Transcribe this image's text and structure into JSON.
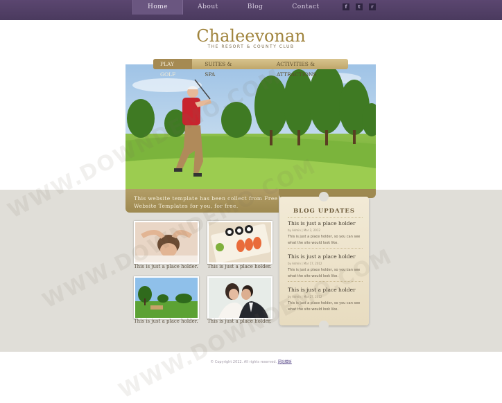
{
  "nav": {
    "items": [
      "Home",
      "About",
      "Blog",
      "Contact"
    ]
  },
  "social": {
    "icons": [
      "facebook-icon",
      "twitter-icon",
      "rss-icon"
    ]
  },
  "logo": {
    "title": "Chaleevonan",
    "subtitle": "THE RESORT & COUNTY CLUB"
  },
  "tabs": [
    "PLAY GOLF",
    "SUITES & SPA",
    "ACTIVITIES & ATTRACTIONS"
  ],
  "hero": {
    "caption": "This website template has been collect from Free Website Templates for you, for free."
  },
  "gallery": [
    {
      "image": "spa-massage",
      "label": "This is just a place holder."
    },
    {
      "image": "sushi-plate",
      "label": "This is just a place holder."
    },
    {
      "image": "golf-course",
      "label": "This is just a place holder."
    },
    {
      "image": "wedding-couple",
      "label": "This is just a place holder."
    }
  ],
  "blog": {
    "heading": "BLOG UPDATES",
    "posts": [
      {
        "title": "This is just a place holder",
        "meta": "by Admin | Mar 2, 2012",
        "text": "This is just a place holder, so you can see what the site would look like."
      },
      {
        "title": "This is just a place holder",
        "meta": "by Admin | Mar 17, 2012",
        "text": "This is just a place holder, so you can see what the site would look like."
      },
      {
        "title": "This is just a place holder",
        "meta": "by Admin | Mar 27, 2012",
        "text": "This is just a place holder, so you can see what the site would look like."
      }
    ]
  },
  "footer": {
    "text": "© Copyright 2012. All rights reserved.",
    "link": "网站模板"
  },
  "watermark": "WWW.DOWNDEMO.COM",
  "colors": {
    "topbar": "#4a3a5e",
    "gold": "#a0843d",
    "band": "#e0ded8"
  }
}
